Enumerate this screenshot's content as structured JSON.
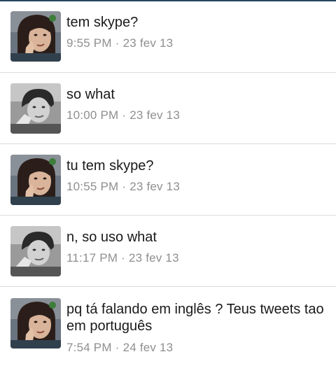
{
  "messages": [
    {
      "text": "tem skype?",
      "time": "9:55 PM",
      "date": "23 fev 13",
      "avatar": "girl-avatar"
    },
    {
      "text": "so what",
      "time": "10:00 PM",
      "date": "23 fev 13",
      "avatar": "boy-avatar"
    },
    {
      "text": "tu tem skype?",
      "time": "10:55 PM",
      "date": "23 fev 13",
      "avatar": "girl-avatar"
    },
    {
      "text": "n, so uso what",
      "time": "11:17 PM",
      "date": "23 fev 13",
      "avatar": "boy-avatar"
    },
    {
      "text": "pq  tá falando em inglês ? Teus tweets tao em português",
      "time": "7:54 PM",
      "date": "24 fev 13",
      "avatar": "girl-avatar"
    }
  ],
  "separator": "·",
  "colors": {
    "text": "#1a1a1a",
    "meta": "#8f8f8f",
    "divider": "#dcdcdc",
    "top_bar": "#23465f"
  }
}
